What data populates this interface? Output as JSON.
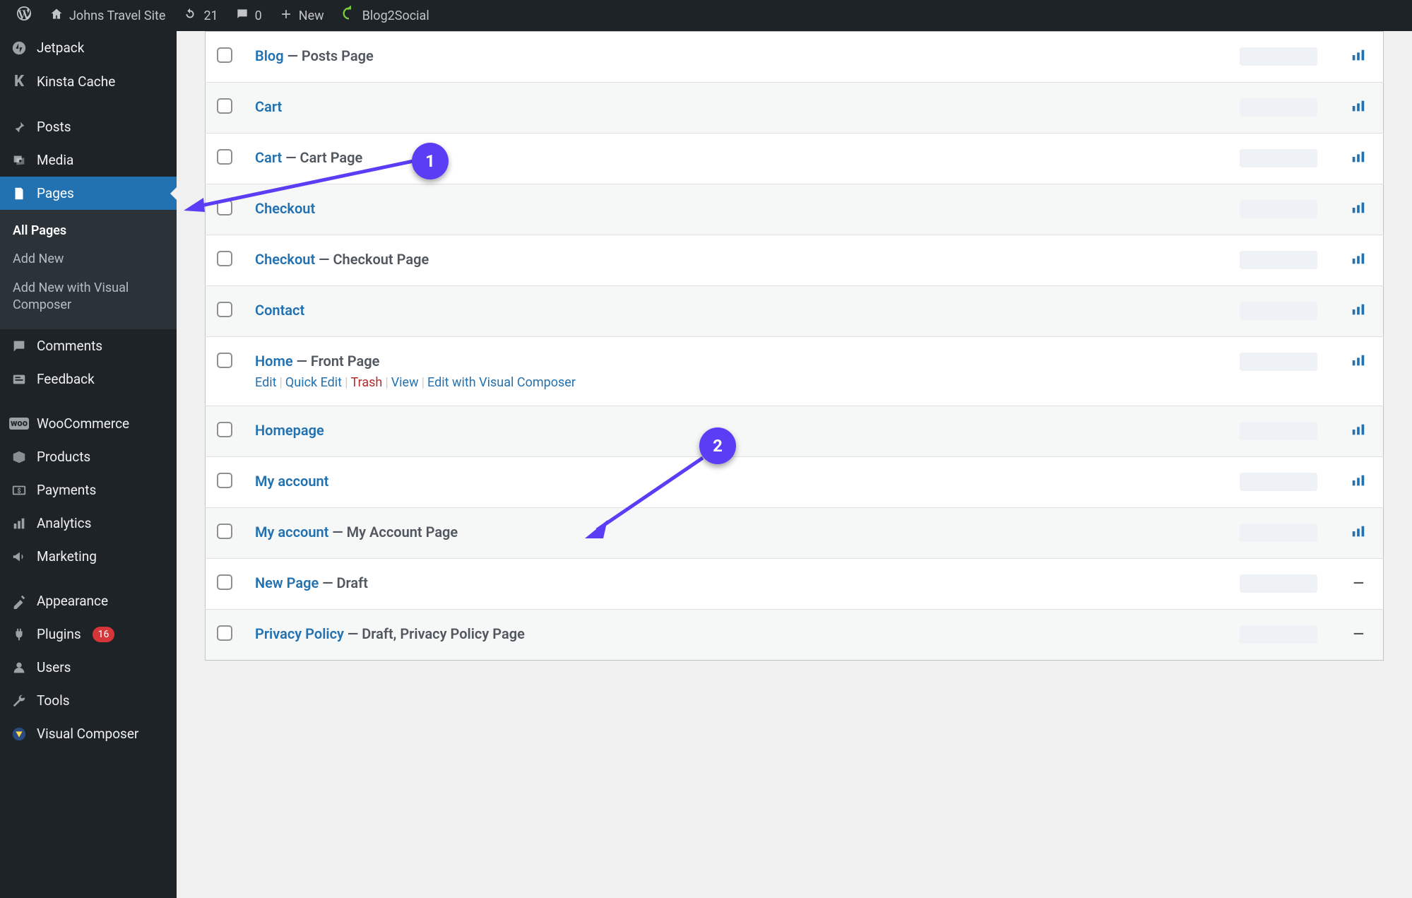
{
  "toolbar": {
    "site_title": "Johns Travel Site",
    "updates_count": "21",
    "comments_count": "0",
    "new_label": "New",
    "blog2social_label": "Blog2Social"
  },
  "sidebar": {
    "items": [
      {
        "label": "Jetpack",
        "icon": "jetpack"
      },
      {
        "label": "Kinsta Cache",
        "icon": "kinsta"
      },
      {
        "label": "Posts",
        "icon": "pin"
      },
      {
        "label": "Media",
        "icon": "media"
      },
      {
        "label": "Pages",
        "icon": "pages",
        "current": true
      },
      {
        "label": "Comments",
        "icon": "comments"
      },
      {
        "label": "Feedback",
        "icon": "feedback"
      },
      {
        "label": "WooCommerce",
        "icon": "woo"
      },
      {
        "label": "Products",
        "icon": "products"
      },
      {
        "label": "Payments",
        "icon": "payments"
      },
      {
        "label": "Analytics",
        "icon": "analytics"
      },
      {
        "label": "Marketing",
        "icon": "marketing"
      },
      {
        "label": "Appearance",
        "icon": "appearance"
      },
      {
        "label": "Plugins",
        "icon": "plugins",
        "badge": "16"
      },
      {
        "label": "Users",
        "icon": "users"
      },
      {
        "label": "Tools",
        "icon": "tools"
      },
      {
        "label": "Visual Composer",
        "icon": "vc"
      }
    ],
    "submenu": {
      "all_pages": "All Pages",
      "add_new": "Add New",
      "add_new_vc": "Add New with Visual Composer"
    }
  },
  "rows": [
    {
      "link": "Blog",
      "suffix": " — Posts Page",
      "stats": true
    },
    {
      "link": "Cart",
      "suffix": "",
      "stats": true
    },
    {
      "link": "Cart",
      "suffix": " — Cart Page",
      "stats": true
    },
    {
      "link": "Checkout",
      "suffix": "",
      "stats": true
    },
    {
      "link": "Checkout",
      "suffix": " — Checkout Page",
      "stats": true
    },
    {
      "link": "Contact",
      "suffix": "",
      "stats": true
    },
    {
      "link": "Home",
      "suffix": " — Front Page",
      "stats": true,
      "actions": true
    },
    {
      "link": "Homepage",
      "suffix": "",
      "stats": true
    },
    {
      "link": "My account",
      "suffix": "",
      "stats": true
    },
    {
      "link": "My account",
      "suffix": " — My Account Page",
      "stats": true
    },
    {
      "link": "New Page",
      "suffix": " — Draft",
      "stats": false
    },
    {
      "link": "Privacy Policy",
      "suffix": " — Draft, Privacy Policy Page",
      "stats": false
    }
  ],
  "row_actions": {
    "edit": "Edit",
    "quick_edit": "Quick Edit",
    "trash": "Trash",
    "view": "View",
    "edit_vc": "Edit with Visual Composer"
  },
  "annotations": {
    "b1": "1",
    "b2": "2"
  }
}
